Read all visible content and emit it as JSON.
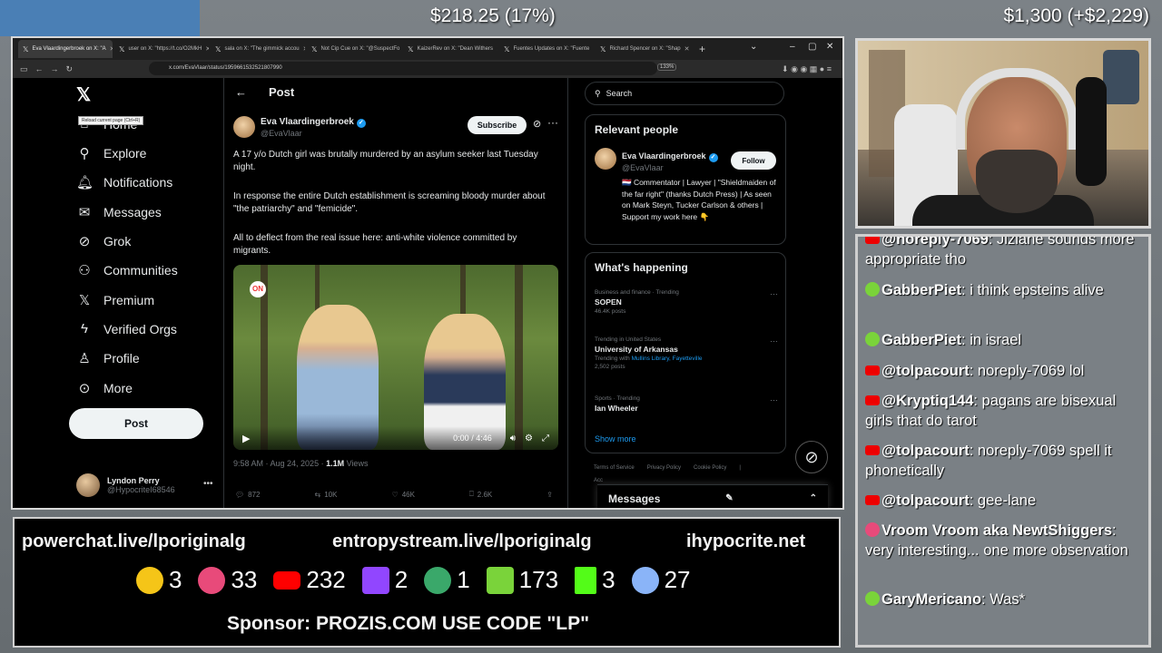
{
  "overlay": {
    "stat_left": "$218.25 (17%)",
    "stat_right": "$1,300 (+$2,229)"
  },
  "browser": {
    "tabs": [
      {
        "label": "Eva Vlaardingerbroek on X: \"A",
        "active": true
      },
      {
        "label": "user on X: \"https://t.co/O2MkH"
      },
      {
        "label": "sala on X: \"The gimmick accou"
      },
      {
        "label": "Not Cip Cue on X: \"@SuspectFo"
      },
      {
        "label": "KaizerRev on X: \"Dean Withers"
      },
      {
        "label": "Fuentes Updates on X: \"Fuente"
      },
      {
        "label": "Richard Spencer on X: \"Shap"
      }
    ],
    "new_tab": "+",
    "url": "x.com/EvaVlaar/status/1959661532521807990",
    "tooltip": "Reload current page (Ctrl+R)",
    "zoom": "133%"
  },
  "nav": {
    "items": [
      {
        "label": "Home",
        "icon": "home-icon"
      },
      {
        "label": "Explore",
        "icon": "search-icon"
      },
      {
        "label": "Notifications",
        "icon": "bell-icon"
      },
      {
        "label": "Messages",
        "icon": "mail-icon"
      },
      {
        "label": "Grok",
        "icon": "grok-icon"
      },
      {
        "label": "Communities",
        "icon": "people-icon"
      },
      {
        "label": "Premium",
        "icon": "x-icon"
      },
      {
        "label": "Verified Orgs",
        "icon": "bolt-icon"
      },
      {
        "label": "Profile",
        "icon": "person-icon"
      },
      {
        "label": "More",
        "icon": "more-circle-icon"
      }
    ],
    "post_label": "Post",
    "user_name": "Lyndon Perry",
    "user_handle": "@HypocriteI68546"
  },
  "post": {
    "header": "Post",
    "author_name": "Eva Vlaardingerbroek",
    "author_handle": "@EvaVlaar",
    "subscribe": "Subscribe",
    "para1": "A 17 y/o Dutch girl was brutally murdered by an asylum seeker last Tuesday night.",
    "para2": "In response the entire Dutch establishment is screaming bloody murder about \"the patriarchy\" and \"femicide\".",
    "para3": "All to deflect from the real issue here: anti-white violence committed by migrants.",
    "video_logo": "ON",
    "video_time": "0:00 / 4:46",
    "timestamp": "9:58 AM · Aug 24, 2025 · ",
    "views_count": "1.1M",
    "views_label": " Views",
    "replies": "872",
    "reposts": "10K",
    "likes": "46K",
    "bookmarks": "2.6K"
  },
  "right": {
    "search_placeholder": "Search",
    "relevant_title": "Relevant people",
    "rp_name": "Eva Vlaardingerbroek",
    "rp_handle": "@EvaVlaar",
    "follow": "Follow",
    "rp_bio": "🇳🇱 Commentator | Lawyer | \"Shieldmaiden of the far right\" (thanks Dutch Press) | As seen on Mark Steyn, Tucker Carlson & others | Support my work here 👇",
    "happening_title": "What's happening",
    "trends": [
      {
        "cat": "Business and finance · Trending",
        "name": "SOPEN",
        "sub": "46.4K posts"
      },
      {
        "cat": "Trending in United States",
        "name": "University of Arkansas",
        "sub_prefix": "Trending with ",
        "sub_link": "Mullins Library, Fayetteville",
        "sub2": "2,502 posts"
      },
      {
        "cat": "Sports · Trending",
        "name": "Ian Wheeler"
      }
    ],
    "show_more": "Show more",
    "footer_links": [
      "Terms of Service",
      "Privacy Policy",
      "Cookie Policy",
      "|"
    ],
    "footer_more": "Acc",
    "messages": "Messages"
  },
  "lower": {
    "link1": "powerchat.live/lporiginalg",
    "link2": "entropystream.live/lporiginalg",
    "link3": "ihypocrite.net",
    "counters": [
      "3",
      "33",
      "232",
      "2",
      "1",
      "173",
      "3",
      "27"
    ],
    "sponsor": "Sponsor: PROZIS.COM USE CODE \"LP\""
  },
  "chat": {
    "messages": [
      {
        "user": "@noreply-7069",
        "text": ": Jiziane sounds more appropriate tho"
      },
      {
        "user": "GabberPiet",
        "text": ": i think epsteins alive"
      },
      {
        "user": "GabberPiet",
        "text": ": in israel"
      },
      {
        "user": "@tolpacourt",
        "text": ": noreply-7069 lol"
      },
      {
        "user": "@Kryptiq144",
        "text": ": pagans are bisexual girls that do tarot"
      },
      {
        "user": "@tolpacourt",
        "text": ": noreply-7069 spell it phonetically"
      },
      {
        "user": "@tolpacourt",
        "text": ": gee-lane"
      },
      {
        "user": "Vroom Vroom aka NewtShiggers",
        "text": ": very interesting... one more observation"
      },
      {
        "user": "GaryMericano",
        "text": ": Was*"
      }
    ]
  }
}
